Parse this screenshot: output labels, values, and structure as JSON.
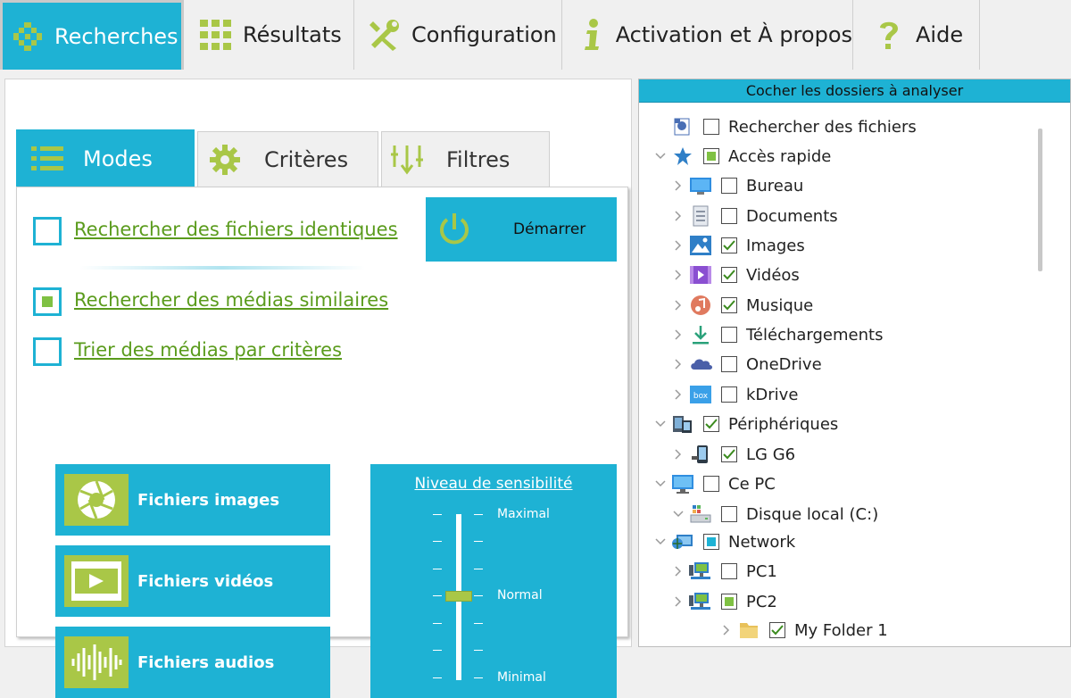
{
  "top_tabs": [
    {
      "label": "Recherches",
      "icon": "search-grid-icon",
      "active": true
    },
    {
      "label": "Résultats",
      "icon": "results-grid-icon",
      "active": false
    },
    {
      "label": "Configuration",
      "icon": "tools-icon",
      "active": false
    },
    {
      "label": "Activation et À propos",
      "icon": "info-icon",
      "active": false
    },
    {
      "label": "Aide",
      "icon": "help-icon",
      "active": false
    }
  ],
  "sub_tabs": [
    {
      "label": "Modes",
      "icon": "list-icon",
      "active": true
    },
    {
      "label": "Critères",
      "icon": "gear-icon",
      "active": false
    },
    {
      "label": "Filtres",
      "icon": "filter-icon",
      "active": false
    }
  ],
  "modes": {
    "identical": {
      "label": "Rechercher des fichiers identiques",
      "checked": false
    },
    "similar": {
      "label": "Rechercher des médias similaires",
      "checked": true
    },
    "sort": {
      "label": "Trier des médias par critères",
      "checked": false
    }
  },
  "start_button": {
    "label": "Démarrer"
  },
  "media_buttons": [
    {
      "label": "Fichiers images",
      "icon": "aperture-icon"
    },
    {
      "label": "Fichiers vidéos",
      "icon": "video-icon"
    },
    {
      "label": "Fichiers audios",
      "icon": "waveform-icon"
    }
  ],
  "sensitivity": {
    "title": "Niveau de sensibilité",
    "labels": {
      "max": "Maximal",
      "normal": "Normal",
      "min": "Minimal"
    },
    "level_percent": 50
  },
  "folders": {
    "header": "Cocher les dossiers à analyser",
    "items": [
      {
        "label": "Rechercher des fichiers",
        "state": "unchecked"
      },
      {
        "label": "Accès rapide",
        "state": "partial"
      },
      {
        "label": "Bureau",
        "state": "unchecked"
      },
      {
        "label": "Documents",
        "state": "unchecked"
      },
      {
        "label": "Images",
        "state": "checked"
      },
      {
        "label": "Vidéos",
        "state": "checked"
      },
      {
        "label": "Musique",
        "state": "checked"
      },
      {
        "label": "Téléchargements",
        "state": "unchecked"
      },
      {
        "label": "OneDrive",
        "state": "unchecked"
      },
      {
        "label": "kDrive",
        "state": "unchecked"
      },
      {
        "label": "Périphériques",
        "state": "checked"
      },
      {
        "label": "LG G6",
        "state": "checked"
      },
      {
        "label": "Ce PC",
        "state": "unchecked"
      },
      {
        "label": "Disque local (C:)",
        "state": "unchecked"
      },
      {
        "label": "Network",
        "state": "partial-blue"
      },
      {
        "label": "PC1",
        "state": "unchecked"
      },
      {
        "label": "PC2",
        "state": "partial"
      },
      {
        "label": "My Folder 1",
        "state": "checked"
      }
    ]
  },
  "colors": {
    "accent": "#1eb2d4",
    "green": "#7fc143",
    "olive": "#a9c747",
    "link": "#5a9b1c"
  }
}
